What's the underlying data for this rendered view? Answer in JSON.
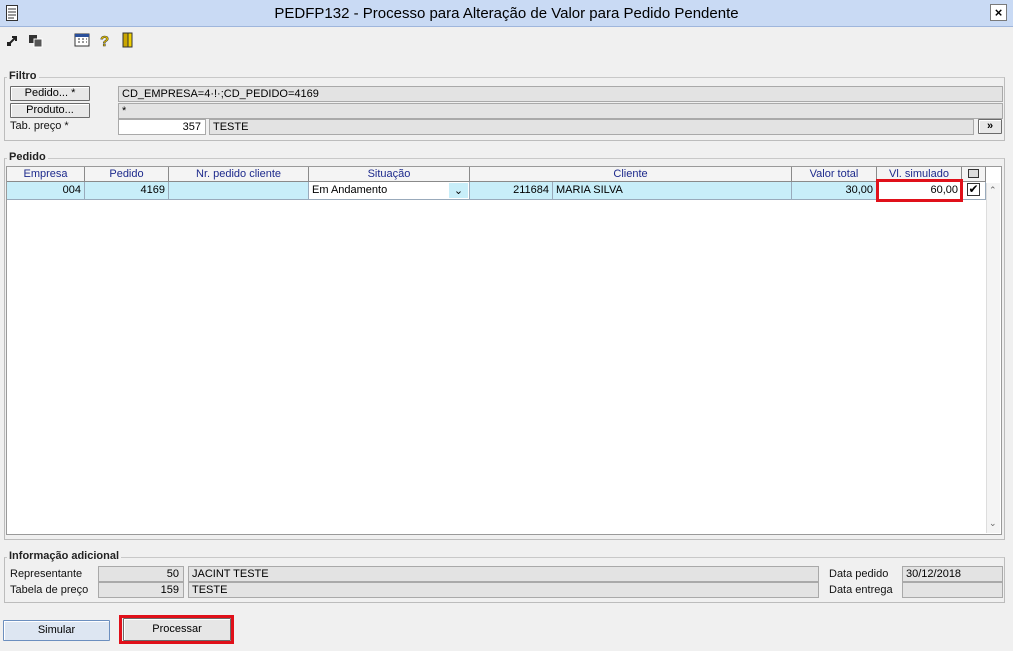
{
  "window": {
    "title": "PEDFP132 - Processo para Alteração de Valor para Pedido Pendente",
    "close_glyph": "×"
  },
  "toolbar": {
    "icons": [
      "export-icon",
      "copy-icon",
      "calendar-icon",
      "help-icon",
      "exit-door-icon"
    ]
  },
  "filtro": {
    "title": "Filtro",
    "pedido_button": "Pedido... *",
    "pedido_value": "CD_EMPRESA=4·!·;CD_PEDIDO=4169",
    "produto_button": "Produto...",
    "produto_value": "*",
    "tab_preco_label": "Tab. preço *",
    "tab_preco_code": "357",
    "tab_preco_desc": "TESTE",
    "next_button": "»"
  },
  "pedido": {
    "title": "Pedido",
    "columns": [
      "Empresa",
      "Pedido",
      "Nr. pedido cliente",
      "Situação",
      "Cliente",
      "Valor total",
      "Vl. simulado"
    ],
    "rows": [
      {
        "empresa": "004",
        "pedido": "4169",
        "nr_pedido_cliente": "",
        "situacao": "Em Andamento",
        "cliente_codigo": "211684",
        "cliente_nome": "MARIA SILVA",
        "valor_total": "30,00",
        "vl_simulado": "60,00",
        "selected": true
      }
    ]
  },
  "info": {
    "title": "Informação adicional",
    "representante_label": "Representante",
    "representante_code": "50",
    "representante_name": "JACINT TESTE",
    "tabela_label": "Tabela de preço",
    "tabela_code": "159",
    "tabela_name": "TESTE",
    "data_pedido_label": "Data pedido",
    "data_pedido_value": "30/12/2018",
    "data_entrega_label": "Data entrega",
    "data_entrega_value": ""
  },
  "footer": {
    "simular_label": "Simular",
    "processar_label": "Processar"
  },
  "colors": {
    "highlight": "#e0101a",
    "row_selected": "#c8eef9",
    "header_text": "#1d2a8c"
  }
}
